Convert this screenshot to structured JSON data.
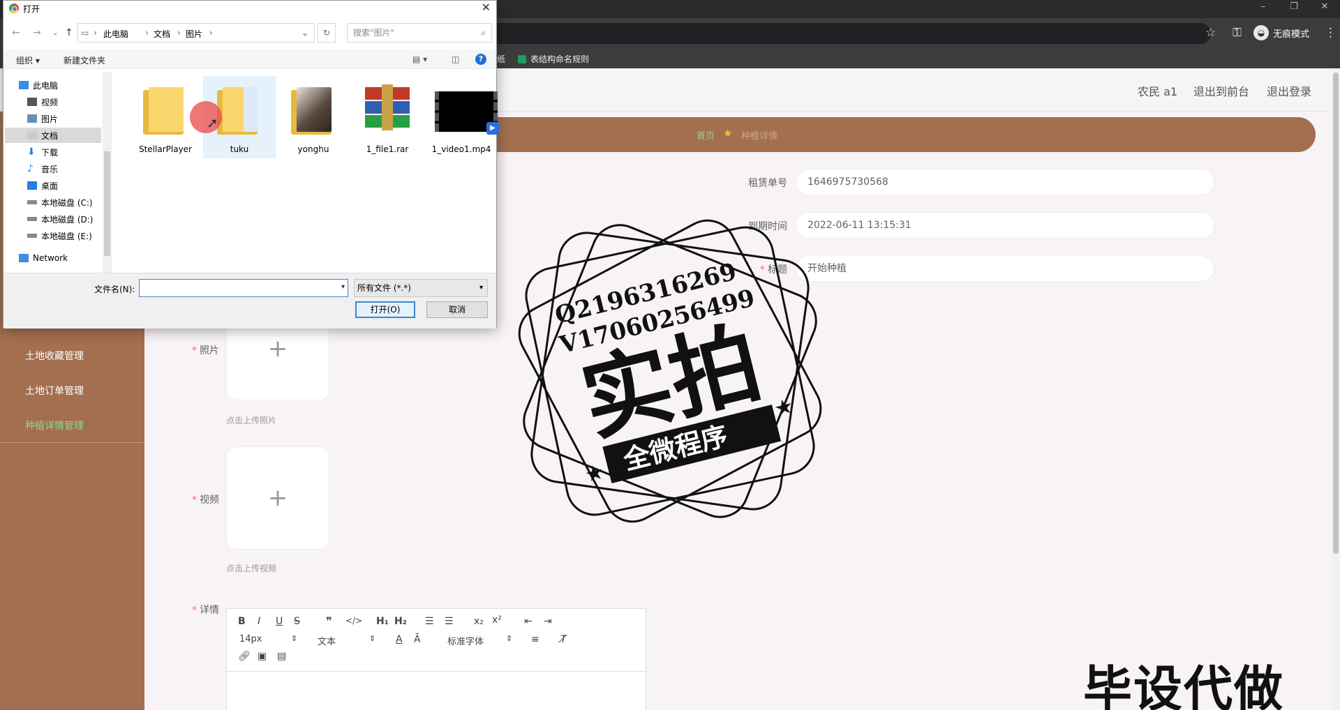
{
  "browser": {
    "window_controls": [
      "–",
      "❐",
      "✕"
    ],
    "incognito_label": "无痕模式",
    "bookmarks": [
      "纸",
      "表结构命名规则"
    ]
  },
  "app": {
    "header_links": [
      "农民 a1",
      "退出到前台",
      "退出登录"
    ],
    "sidebar_items": [
      {
        "label": "土地收藏管理",
        "active": false
      },
      {
        "label": "土地订单管理",
        "active": false
      },
      {
        "label": "种植详情管理",
        "active": true
      }
    ],
    "breadcrumb": {
      "home": "首页",
      "current": "种植详情"
    },
    "form": {
      "order_no_label": "租赁单号",
      "order_no_value": "1646975730568",
      "expire_label": "到期时间",
      "expire_value": "2022-06-11 13:15:31",
      "title_label": "标题",
      "title_value": "开始种植",
      "photo_label": "照片",
      "photo_hint": "点击上传照片",
      "video_label": "视频",
      "video_hint": "点击上传视频",
      "detail_label": "详情"
    },
    "editor": {
      "font_size": "14px",
      "block_type": "文本",
      "font_family": "标准字体"
    }
  },
  "dialog": {
    "title": "打开",
    "path": [
      "此电脑",
      "文档",
      "图片"
    ],
    "search_placeholder": "搜索\"图片\"",
    "organize_label": "组织",
    "new_folder_label": "新建文件夹",
    "nav_items": [
      "此电脑",
      "视频",
      "图片",
      "文档",
      "下载",
      "音乐",
      "桌面",
      "本地磁盘 (C:)",
      "本地磁盘 (D:)",
      "本地磁盘 (E:)",
      "Network"
    ],
    "selected_nav": "文档",
    "files": [
      {
        "name": "StellarPlayer",
        "kind": "folder"
      },
      {
        "name": "tuku",
        "kind": "folder"
      },
      {
        "name": "yonghu",
        "kind": "folder-photo"
      },
      {
        "name": "1_file1.rar",
        "kind": "rar"
      },
      {
        "name": "1_video1.mp4",
        "kind": "video"
      }
    ],
    "selected_file": "tuku",
    "filename_label": "文件名(N):",
    "filename_value": "",
    "filetype_value": "所有文件 (*.*)",
    "open_button": "打开(O)",
    "cancel_button": "取消"
  },
  "watermark": {
    "line1": "Q2196316269",
    "line2": "V17060256499",
    "big_text": "实拍",
    "ribbon_text": "全微程序",
    "corner_text": "毕设代做"
  }
}
